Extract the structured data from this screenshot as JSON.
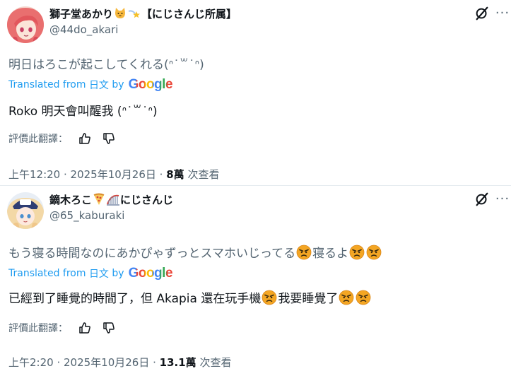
{
  "tweets": [
    {
      "display_name": "獅子堂あかり",
      "affiliation": "【にじさんじ所属】",
      "handle": "@44do_akari",
      "original_text": "明日はろこが起こしてくれる(ᐢ˙꒳˙ᐢ)",
      "translated_from_prefix": "Translated from",
      "source_language": "日文",
      "by_label": "by",
      "google_label": "Google",
      "translated_text": "Roko 明天會叫醒我 (ᐢ˙꒳˙ᐢ)",
      "rate_label": "評價此翻譯：",
      "time": "上午12:20",
      "date": "2025年10月26日",
      "views_count": "8萬",
      "views_label": "次查看"
    },
    {
      "display_name": "鏑木ろこ",
      "suffix": "にじさんじ",
      "handle": "@65_kaburaki",
      "original_text_a": "もう寝る時間なのにあかぴゃずっとスマホいじってる",
      "original_text_b": "寝るよ",
      "translated_from_prefix": "Translated from",
      "source_language": "日文",
      "by_label": "by",
      "google_label": "Google",
      "translated_text_a": "已經到了睡覺的時間了，但 Akapia 還在玩手機",
      "translated_text_b": "我要睡覺了",
      "rate_label": "評價此翻譯：",
      "time": "上午2:20",
      "date": "2025年10月26日",
      "views_count": "13.1萬",
      "views_label": "次查看"
    }
  ],
  "icons": {
    "grok": "grok-slash-icon",
    "thumbs_up": "thumbs-up-icon",
    "thumbs_down": "thumbs-down-icon",
    "angry": "angry-face-emoji"
  },
  "colors": {
    "link": "#1d9bf0",
    "secondary": "#536471",
    "text": "#0f1419",
    "google_blue": "#4285f4",
    "google_red": "#ea4335",
    "google_yellow": "#fbbc05",
    "google_green": "#34a853"
  }
}
